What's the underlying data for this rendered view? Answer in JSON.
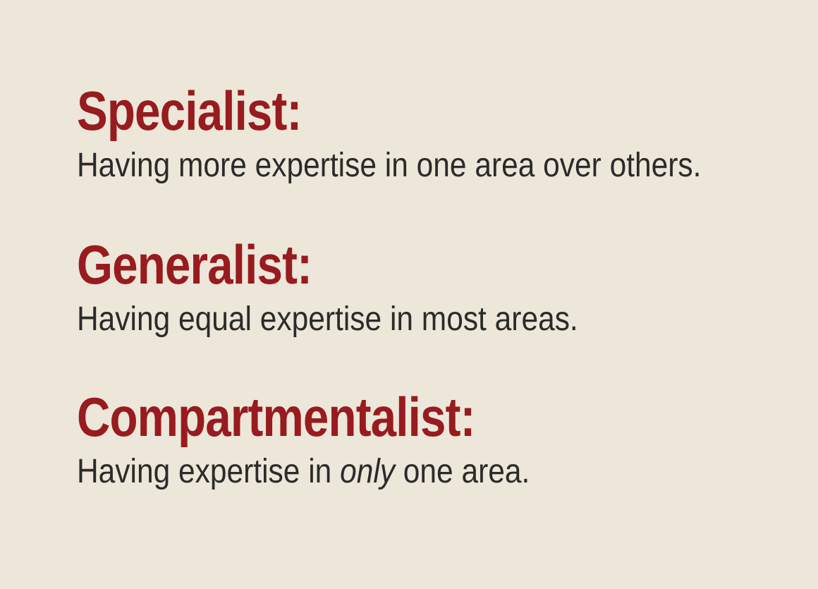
{
  "background_color": "#ece7d8",
  "term_color": "#971b1f",
  "text_color": "#2b2b2b",
  "definitions": [
    {
      "term": "Specialist:",
      "definition": "Having more expertise in one area over others."
    },
    {
      "term": "Generalist:",
      "definition": "Having equal expertise in most areas."
    },
    {
      "term": "Compartmentalist:",
      "definition_before": "Having expertise in ",
      "definition_emphasis": "only",
      "definition_after": " one area."
    }
  ]
}
